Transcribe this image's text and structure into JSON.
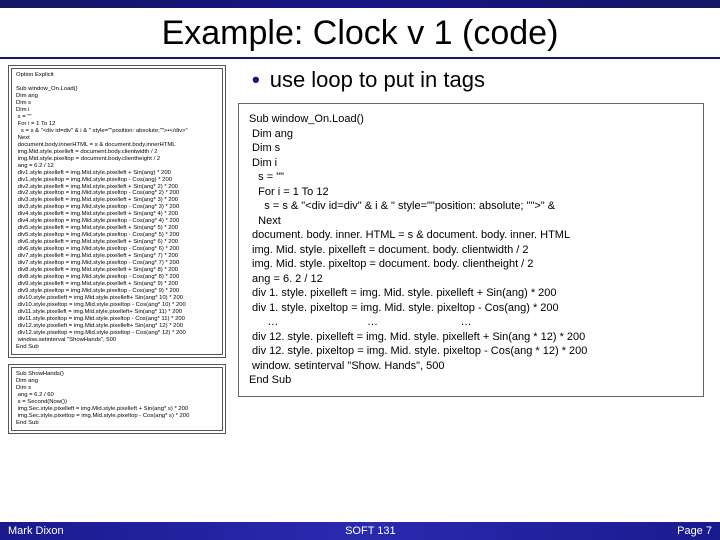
{
  "title": "Example: Clock v 1 (code)",
  "bullet": "use loop to put in tags",
  "code_left_main": "Option Explicit\n\nSub window_On.Load()\nDim ang\nDim s\nDim i\n s = \"\"\n For i = 1 To 12\n   s = s & \"<div id=div\" & i & \" style=\"\"position: absolute;\"\">•</div>\"\n Next\n document.body.innerHTML = s & document.body.innerHTML\n img.Mid.style.pixelleft = document.body.clientwidth / 2\n img.Mid.style.pixeltop = document.body.clientheight / 2\n ang = 6.2 / 12\n div1.style.pixelleft = img.Mid.style.pixelleft + Sin(ang) * 200\n div1.style.pixeltop = img.Mid.style.pixeltop - Cos(ang) * 200\n div2.style.pixelleft = img.Mid.style.pixelleft + Sin(ang* 2) * 200\n div2.style.pixeltop = img.Mid.style.pixeltop - Cos(ang* 2) * 200\n div3.style.pixelleft = img.Mid.style.pixelleft + Sin(ang* 3) * 200\n div3.style.pixeltop = img.Mid.style.pixeltop - Cos(ang* 3) * 200\n div4.style.pixelleft = img.Mid.style.pixelleft + Sin(ang* 4) * 200\n div4.style.pixeltop = img.Mid.style.pixeltop - Cos(ang* 4) * 200\n div5.style.pixelleft = img.Mid.style.pixelleft + Sin(ang* 5) * 200\n div5.style.pixeltop = img.Mid.style.pixeltop - Cos(ang* 5) * 200\n div6.style.pixelleft = img.Mid.style.pixelleft + Sin(ang* 6) * 200\n div6.style.pixeltop = img.Mid.style.pixeltop - Cos(ang* 6) * 200\n div7.style.pixelleft = img.Mid.style.pixelleft + Sin(ang* 7) * 200\n div7.style.pixeltop = img.Mid.style.pixeltop - Cos(ang* 7) * 200\n div8.style.pixelleft = img.Mid.style.pixelleft + Sin(ang* 8) * 200\n div8.style.pixeltop = img.Mid.style.pixeltop - Cos(ang* 8) * 200\n div9.style.pixelleft = img.Mid.style.pixelleft + Sin(ang* 9) * 200\n div9.style.pixeltop = img.Mid.style.pixeltop - Cos(ang* 9) * 200\n div10.style.pixelleft = img.Mid.style.pixelleft+ Sin(ang* 10) * 200\n div10.style.pixeltop = img.Mid.style.pixeltop - Cos(ang* 10) * 200\n div11.style.pixelleft = img.Mid.style.pixelleft+ Sin(ang* 11) * 200\n div11.style.pixeltop = img.Mid.style.pixeltop - Cos(ang* 11) * 200\n div12.style.pixelleft = img.Mid.style.pixelleft+ Sin(ang* 12) * 200\n div12.style.pixeltop = img.Mid.style.pixeltop - Cos(ang* 12) * 200\n window.setinterval \"ShowHands\", 500\nEnd Sub",
  "code_left_hands": "Sub ShowHands()\nDim ang\nDim s\n ang = 6.2 / 60\n s = Second(Now())\n img.Sec.style.pixelleft = img.Mid.style.pixelleft + Sin(ang* s) * 200\n img.Sec.style.pixeltop = img.Mid.style.pixeltop - Cos(ang* s) * 200\nEnd Sub",
  "code_right": "Sub window_On.Load()\n Dim ang\n Dim s\n Dim i\n   s = \"\"\n   For i = 1 To 12\n     s = s & \"<div id=div\" & i & \" style=\"\"position: absolute; \"\">\" &\n   Next\n document. body. inner. HTML = s & document. body. inner. HTML\n img. Mid. style. pixelleft = document. body. clientwidth / 2\n img. Mid. style. pixeltop = document. body. clientheight / 2\n ang = 6. 2 / 12\n div 1. style. pixelleft = img. Mid. style. pixelleft + Sin(ang) * 200\n div 1. style. pixeltop = img. Mid. style. pixeltop - Cos(ang) * 200\n      …                             …                           …\n div 12. style. pixelleft = img. Mid. style. pixelleft + Sin(ang * 12) * 200\n div 12. style. pixeltop = img. Mid. style. pixeltop - Cos(ang * 12) * 200\n window. setinterval \"Show. Hands\", 500\nEnd Sub",
  "footer": {
    "left": "Mark Dixon",
    "center": "SOFT 131",
    "right": "Page 7"
  }
}
